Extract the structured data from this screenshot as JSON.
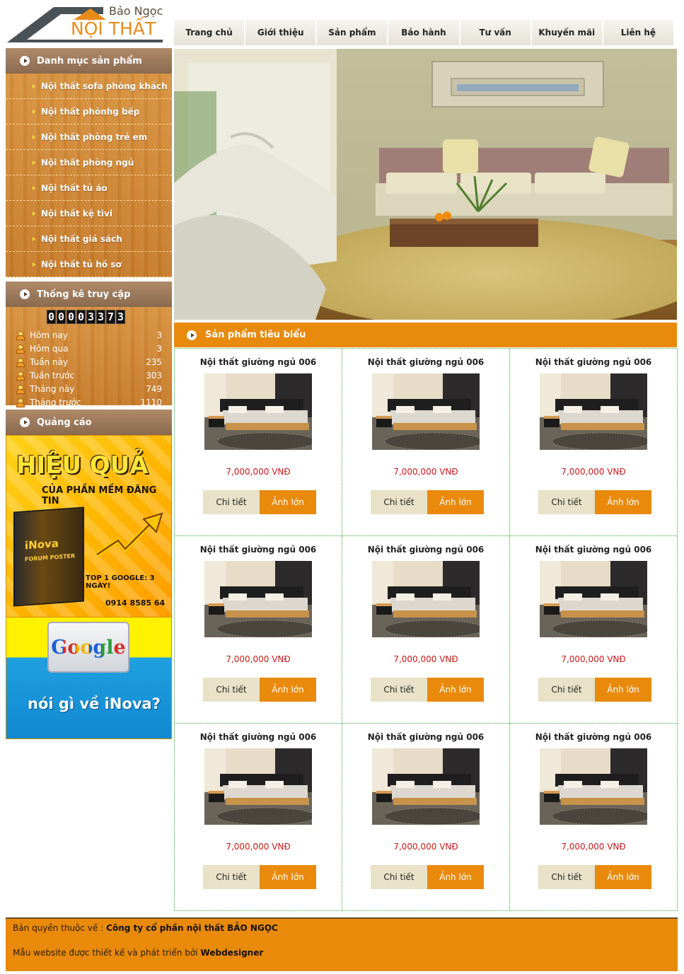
{
  "logo": {
    "top_text": "Bảo Ngọc",
    "main_text": "NỘI THẤT"
  },
  "nav": {
    "items": [
      "Trang chủ",
      "Giới thiệu",
      "Sản phẩm",
      "Bảo hành",
      "Tư vấn",
      "Khuyến mãi",
      "Liên hệ"
    ]
  },
  "sidebar": {
    "categories": {
      "title": "Danh mục sản phẩm",
      "items": [
        "Nội thất sofa phòng khách",
        "Nội thất phònhg bếp",
        "Nội thất phòng trẻ em",
        "Nội thất phòng ngủ",
        "Nội thất tủ áo",
        "Nội thất kệ tivi",
        "Nội thất giá sách",
        "Nội thất tủ hồ sơ"
      ]
    },
    "stats": {
      "title": "Thống kê truy cập",
      "counter": "00003373",
      "rows": [
        {
          "label": "Hôm nay",
          "value": "3"
        },
        {
          "label": "Hôm qua",
          "value": "3"
        },
        {
          "label": "Tuần này",
          "value": "235"
        },
        {
          "label": "Tuần trước",
          "value": "303"
        },
        {
          "label": "Tháng này",
          "value": "749"
        },
        {
          "label": "Tháng trước",
          "value": "1110"
        }
      ]
    },
    "ads": {
      "title": "Quảng cáo",
      "ad1": {
        "headline": "HIỆU QUẢ",
        "sub": "CỦA PHẦN MỀM ĐĂNG TIN",
        "product": "iNova",
        "product_sub": "FORUM POSTER",
        "tagline": "TOP 1 GOOGLE: 3 NGÀY!",
        "phone": "0914 8585 64"
      },
      "ad2": {
        "logo": "Google",
        "question": "nói gì về iNova?"
      }
    }
  },
  "featured": {
    "title": "Sản phẩm tiêu biểu",
    "products": [
      {
        "name": "Nội thất giường ngủ 006",
        "price": "7,000,000 VNĐ",
        "detail_label": "Chi tiết",
        "large_label": "Ảnh lớn"
      },
      {
        "name": "Nội thất giường ngủ 006",
        "price": "7,000,000 VNĐ",
        "detail_label": "Chi tiết",
        "large_label": "Ảnh lớn"
      },
      {
        "name": "Nội thất giường ngủ 006",
        "price": "7,000,000 VNĐ",
        "detail_label": "Chi tiết",
        "large_label": "Ảnh lớn"
      },
      {
        "name": "Nội thất giường ngủ 006",
        "price": "7,000,000 VNĐ",
        "detail_label": "Chi tiết",
        "large_label": "Ảnh lớn"
      },
      {
        "name": "Nội thất giường ngủ 006",
        "price": "7,000,000 VNĐ",
        "detail_label": "Chi tiết",
        "large_label": "Ảnh lớn"
      },
      {
        "name": "Nội thất giường ngủ 006",
        "price": "7,000,000 VNĐ",
        "detail_label": "Chi tiết",
        "large_label": "Ảnh lớn"
      },
      {
        "name": "Nội thất giường ngủ 006",
        "price": "7,000,000 VNĐ",
        "detail_label": "Chi tiết",
        "large_label": "Ảnh lớn"
      },
      {
        "name": "Nội thất giường ngủ 006",
        "price": "7,000,000 VNĐ",
        "detail_label": "Chi tiết",
        "large_label": "Ảnh lớn"
      },
      {
        "name": "Nội thất giường ngủ 006",
        "price": "7,000,000 VNĐ",
        "detail_label": "Chi tiết",
        "large_label": "Ảnh lớn"
      }
    ]
  },
  "footer": {
    "copyright_prefix": "Bản quyền thuộc về :",
    "company": "Công ty cổ phần nội thất BẢO NGỌC",
    "design_prefix": "Mẫu website được thiết kế và phát triển bởi",
    "designer": "Webdesigner"
  },
  "colors": {
    "accent_orange": "#e88a0c",
    "sidebar_header_brown": "#8a6a4f",
    "price_red": "#c81a1a",
    "grid_border_green": "#3aa03a"
  }
}
